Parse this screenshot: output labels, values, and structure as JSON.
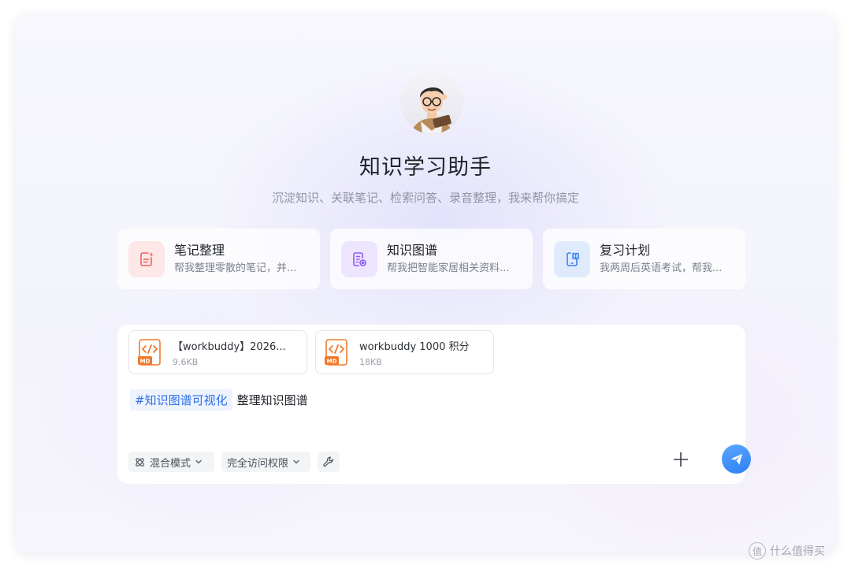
{
  "assistant": {
    "name": "知识学习助手",
    "tagline": "沉淀知识、关联笔记、检索问答、录音整理，我来帮你搞定"
  },
  "cards": [
    {
      "title": "笔记整理",
      "desc": "帮我整理零散的笔记，并...",
      "icon": "note-edit-icon",
      "color": "#f0625f"
    },
    {
      "title": "知识图谱",
      "desc": "帮我把智能家居相关资料...",
      "icon": "document-link-icon",
      "color": "#8b5cf6"
    },
    {
      "title": "复习计划",
      "desc": "我两周后英语考试，帮我...",
      "icon": "book-phone-icon",
      "color": "#3b82f6"
    }
  ],
  "attachments": [
    {
      "name": "【workbuddy】2026...",
      "size": "9.6KB",
      "type": "MD"
    },
    {
      "name": "workbuddy 1000 积分",
      "size": "18KB",
      "type": "MD"
    }
  ],
  "composer": {
    "tag": "#知识图谱可视化",
    "text": "整理知识图谱"
  },
  "toolbar": {
    "mode_label": "混合模式",
    "access_label": "完全访问权限"
  },
  "watermark": {
    "text": "什么值得买",
    "logo": "值"
  }
}
